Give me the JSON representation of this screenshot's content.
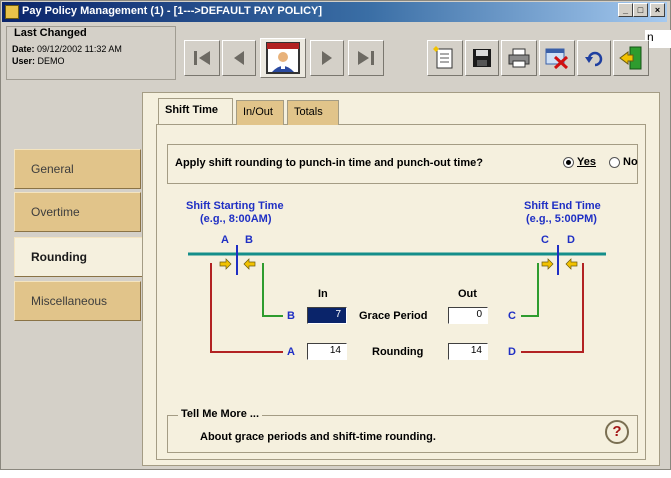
{
  "window": {
    "title": "Pay Policy Management (1) - [1--->DEFAULT PAY POLICY]",
    "overflow_text": "n",
    "min_glyph": "_",
    "max_glyph": "□",
    "close_glyph": "×"
  },
  "header": {
    "last_changed_title": "Last Changed",
    "date_label": "Date:",
    "date_value": "09/12/2002 11:32 AM",
    "user_label": "User:",
    "user_value": "DEMO"
  },
  "toolbar": {
    "icons": [
      "first-record-icon",
      "previous-record-icon",
      "employee-icon",
      "next-record-icon",
      "last-record-icon",
      "new-document-icon",
      "save-icon",
      "print-icon",
      "delete-icon",
      "undo-icon",
      "exit-icon"
    ]
  },
  "sidebar": {
    "items": [
      {
        "label": "General"
      },
      {
        "label": "Overtime"
      },
      {
        "label": "Rounding",
        "active": true
      },
      {
        "label": "Miscellaneous"
      }
    ]
  },
  "tabs": [
    {
      "label": "Shift Time",
      "active": true
    },
    {
      "label": "In/Out"
    },
    {
      "label": "Totals"
    }
  ],
  "rounding": {
    "question": "Apply shift rounding to punch-in time and punch-out time?",
    "options": {
      "yes": "Yes",
      "no": "No"
    },
    "selected": "yes",
    "shift_start_label": "Shift Starting Time",
    "shift_start_example": "(e.g., 8:00AM)",
    "shift_end_label": "Shift End Time",
    "shift_end_example": "(e.g., 5:00PM)",
    "markers": {
      "a": "A",
      "b": "B",
      "c": "C",
      "d": "D"
    },
    "col_in": "In",
    "col_out": "Out",
    "grace_label": "Grace Period",
    "rounding_label": "Rounding",
    "grace_in": "7",
    "grace_out": "0",
    "rounding_in": "14",
    "rounding_out": "14"
  },
  "tell_me_more": {
    "title": "Tell Me More ...",
    "link": "About grace periods and shift-time rounding.",
    "help_glyph": "?"
  },
  "colors": {
    "accent_blue": "#1f2fc4",
    "line_teal": "#148e8a",
    "line_green": "#2e9c2e",
    "line_red": "#b22222",
    "panel": "#f5f0de",
    "tab_tan": "#e1c48a"
  }
}
